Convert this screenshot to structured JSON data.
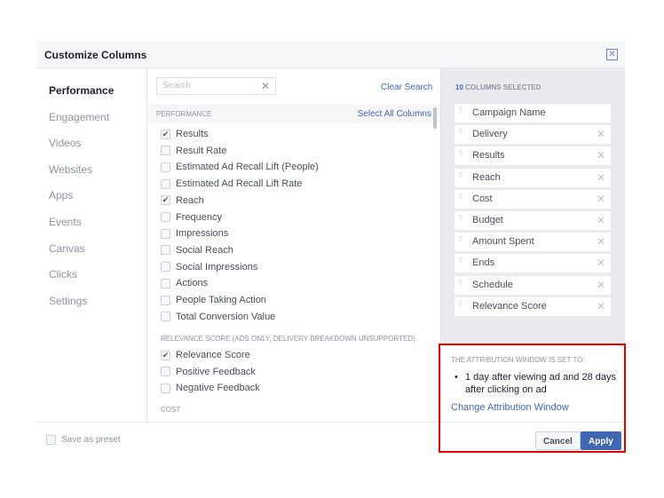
{
  "dialog": {
    "title": "Customize Columns"
  },
  "nav": [
    "Performance",
    "Engagement",
    "Videos",
    "Websites",
    "Apps",
    "Events",
    "Canvas",
    "Clicks",
    "Settings"
  ],
  "search": {
    "placeholder": "Search",
    "clear_label": "Clear Search"
  },
  "sections": {
    "performance": "PERFORMANCE",
    "select_all": "Select All Columns",
    "relevance": "RELEVANCE SCORE (ADS ONLY, DELIVERY BREAKDOWN UNSUPPORTED)",
    "cost": "COST"
  },
  "performance_items": [
    {
      "label": "Results",
      "checked": true
    },
    {
      "label": "Result Rate",
      "checked": false
    },
    {
      "label": "Estimated Ad Recall Lift (People)",
      "checked": false
    },
    {
      "label": "Estimated Ad Recall Lift Rate",
      "checked": false
    },
    {
      "label": "Reach",
      "checked": true
    },
    {
      "label": "Frequency",
      "checked": false
    },
    {
      "label": "Impressions",
      "checked": false
    },
    {
      "label": "Social Reach",
      "checked": false
    },
    {
      "label": "Social Impressions",
      "checked": false
    },
    {
      "label": "Actions",
      "checked": false
    },
    {
      "label": "People Taking Action",
      "checked": false
    },
    {
      "label": "Total Conversion Value",
      "checked": false
    }
  ],
  "relevance_items": [
    {
      "label": "Relevance Score",
      "checked": true
    },
    {
      "label": "Positive Feedback",
      "checked": false
    },
    {
      "label": "Negative Feedback",
      "checked": false
    }
  ],
  "selected": {
    "count": "10",
    "label": "COLUMNS SELECTED",
    "columns": [
      "Campaign Name",
      "Delivery",
      "Results",
      "Reach",
      "Cost",
      "Budget",
      "Amount Spent",
      "Ends",
      "Schedule",
      "Relevance Score"
    ]
  },
  "attribution": {
    "title": "THE ATTRIBUTION WINDOW IS SET TO:",
    "text": "1 day after viewing ad and 28 days after clicking on ad",
    "link": "Change Attribution Window"
  },
  "footer": {
    "preset": "Save as preset",
    "cancel": "Cancel",
    "apply": "Apply"
  },
  "colors": {
    "accent": "#4267b2",
    "highlight": "#e00000"
  }
}
